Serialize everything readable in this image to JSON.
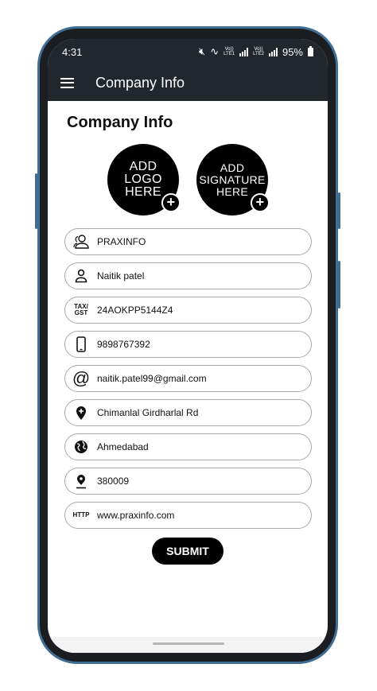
{
  "status": {
    "time": "4:31",
    "sim1": "LTE1",
    "sim2": "LTE2",
    "vo1": "Vo))",
    "vo2": "Vo))",
    "battery": "95%"
  },
  "appbar": {
    "title": "Company Info"
  },
  "page": {
    "title": "Company Info"
  },
  "uploads": {
    "logo_label": "ADD LOGO HERE",
    "logo_lines": [
      "ADD",
      "LOGO",
      "HERE"
    ],
    "signature_lines": [
      "ADD",
      "SIGNATURE",
      "HERE"
    ]
  },
  "form": {
    "company_name": "PRAXINFO",
    "owner_name": "Naitik patel",
    "tax_label_1": "TAX/",
    "tax_label_2": "GST",
    "tax_number": "24AOKPP5144Z4",
    "phone": "9898767392",
    "email": "naitik.patel99@gmail.com",
    "address": "Chimanlal Girdharlal Rd",
    "city": "Ahmedabad",
    "pincode": "380009",
    "website_label": "HTTP",
    "website": "www.praxinfo.com"
  },
  "submit_label": "SUBMIT",
  "colors": {
    "appbar": "#22262d",
    "frame": "#3f6d94",
    "button": "#000000"
  }
}
